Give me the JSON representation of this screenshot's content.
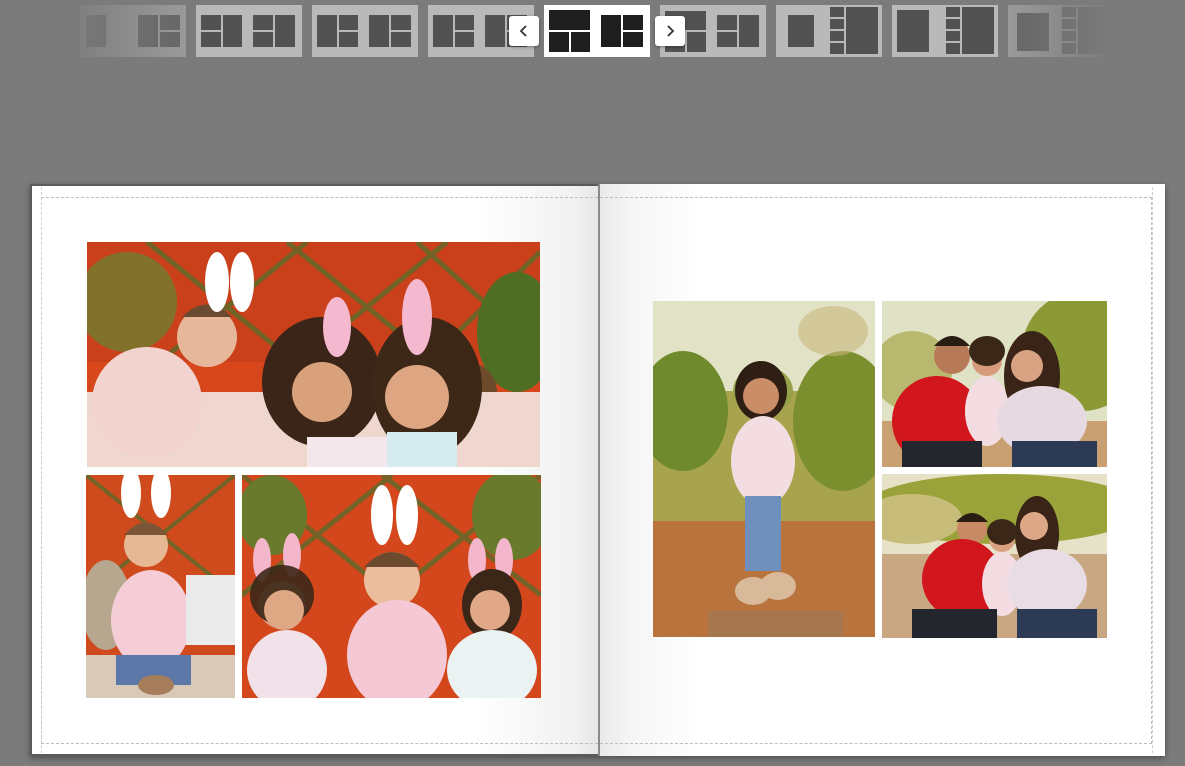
{
  "carousel": {
    "prev_icon": "chevron-left-icon",
    "next_icon": "chevron-right-icon",
    "layouts": [
      {
        "name": "layout-thumb-1",
        "selected": false
      },
      {
        "name": "layout-thumb-2",
        "selected": false
      },
      {
        "name": "layout-thumb-3",
        "selected": false
      },
      {
        "name": "layout-thumb-4",
        "selected": false
      },
      {
        "name": "layout-thumb-5",
        "selected": true
      },
      {
        "name": "layout-thumb-6",
        "selected": false
      },
      {
        "name": "layout-thumb-7",
        "selected": false
      },
      {
        "name": "layout-thumb-8",
        "selected": false
      },
      {
        "name": "layout-thumb-9",
        "selected": false
      }
    ]
  },
  "album": {
    "left_page": {
      "photos": [
        {
          "name": "photo-easter-kids-lying"
        },
        {
          "name": "photo-toddler-bunny-ears"
        },
        {
          "name": "photo-three-girls-easter"
        }
      ]
    },
    "right_page": {
      "photos": [
        {
          "name": "photo-girl-standing-stump"
        },
        {
          "name": "photo-family-kiss"
        },
        {
          "name": "photo-family-crouching"
        }
      ]
    }
  },
  "colors": {
    "workspace_bg": "#7b7b7b",
    "thumb_bg": "#b9b9b9",
    "thumb_selected_bg": "#ffffff",
    "page_bg": "#ffffff"
  }
}
